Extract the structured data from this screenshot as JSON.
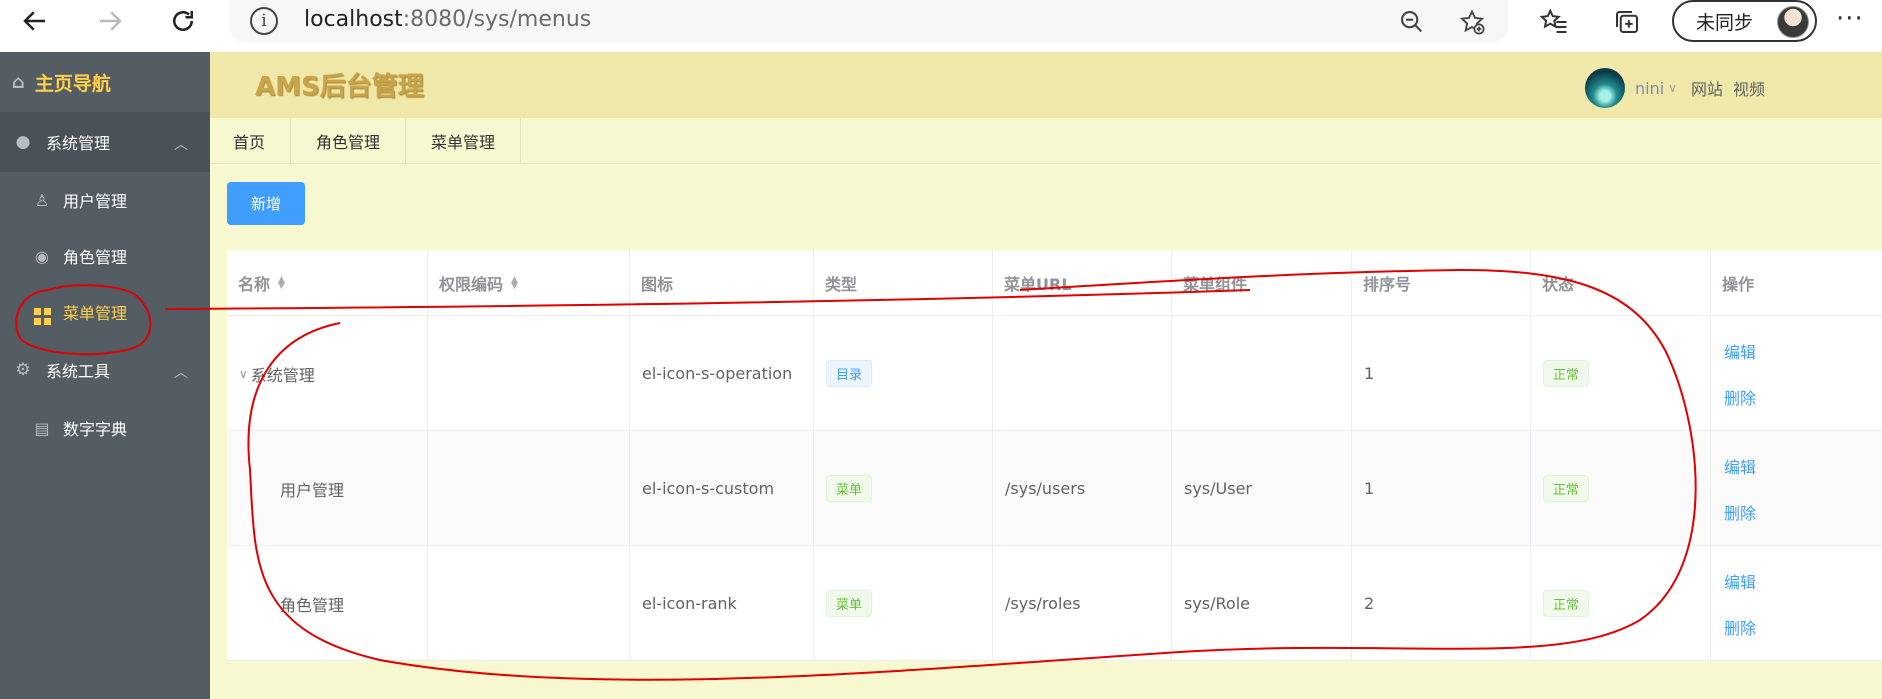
{
  "browser": {
    "url_host": "localhost",
    "url_rest": ":8080/sys/menus",
    "sync_label": "未同步"
  },
  "sidebar": {
    "title": "主页导航",
    "groups": [
      {
        "label": "系统管理",
        "items": [
          "用户管理",
          "角色管理",
          "菜单管理"
        ]
      },
      {
        "label": "系统工具",
        "items": [
          "数字字典"
        ]
      }
    ]
  },
  "header": {
    "brand": "AMS后台管理",
    "username": "nini",
    "links": [
      "网站",
      "视频"
    ]
  },
  "tabs": [
    "首页",
    "角色管理",
    "菜单管理"
  ],
  "toolbar": {
    "add_label": "新增"
  },
  "table": {
    "columns": [
      "名称",
      "权限编码",
      "图标",
      "类型",
      "菜单URL",
      "菜单组件",
      "排序号",
      "状态",
      "操作"
    ],
    "rows": [
      {
        "name": "系统管理",
        "perms": "",
        "icon": "el-icon-s-operation",
        "type": "目录",
        "url": "",
        "component": "",
        "order": "1",
        "status": "正常",
        "edit": "编辑",
        "delete": "删除"
      },
      {
        "name": "用户管理",
        "perms": "",
        "icon": "el-icon-s-custom",
        "type": "菜单",
        "url": "/sys/users",
        "component": "sys/User",
        "order": "1",
        "status": "正常",
        "edit": "编辑",
        "delete": "删除"
      },
      {
        "name": "角色管理",
        "perms": "",
        "icon": "el-icon-rank",
        "type": "菜单",
        "url": "/sys/roles",
        "component": "sys/Role",
        "order": "2",
        "status": "正常",
        "edit": "编辑",
        "delete": "删除"
      }
    ]
  },
  "colors": {
    "sidebar_bg": "#545c64",
    "active_text": "#ffd04b",
    "header_bg": "#f0e8a8",
    "main_bg": "#f8f8d0",
    "primary": "#409eff",
    "annotation": "#e00000"
  }
}
